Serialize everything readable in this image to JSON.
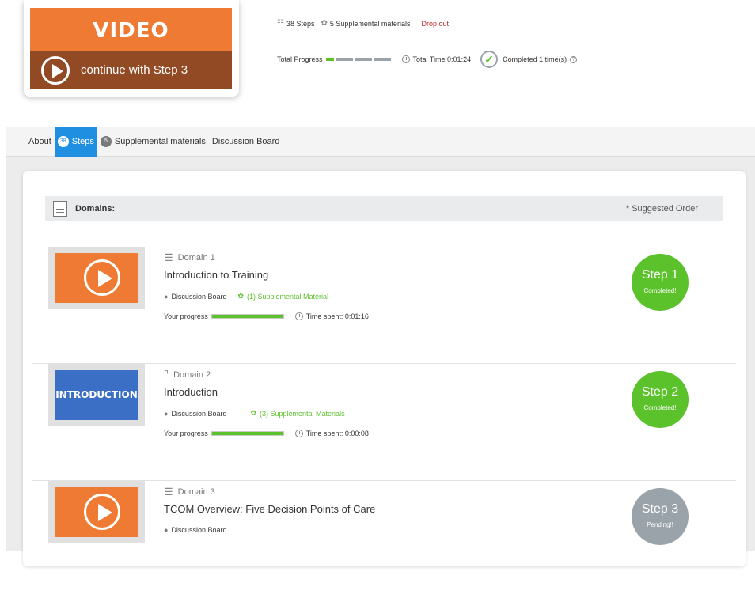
{
  "hero": {
    "video_label": "VIDEO",
    "continue_label": "continue with Step 3"
  },
  "summary": {
    "steps": "38 Steps",
    "supplemental": "5 Supplemental materials",
    "drop_out": "Drop out",
    "total_progress_label": "Total Progress",
    "total_progress_value": 0.05,
    "total_time": "Total Time 0:01:24",
    "completed": "Completed 1 time(s)"
  },
  "tabs": {
    "about": "About",
    "steps_count": "38",
    "steps": "Steps",
    "supp_count": "5",
    "supplemental": "Supplemental materials",
    "discussion": "Discussion Board"
  },
  "domains_header": {
    "title": "Domains:",
    "suggested": "* Suggested Order"
  },
  "steps": [
    {
      "thumb_label": "",
      "domain": "Domain 1",
      "title": "Introduction to Training",
      "discussion": "Discussion Board",
      "supplemental": "(1) Supplemental Material",
      "progress_label": "Your progress",
      "progress": 1.0,
      "time_spent": "Time spent: 0:01:16",
      "badge_step": "Step 1",
      "badge_status": "Completed!",
      "status_color": "#5cc22c"
    },
    {
      "thumb_label": "INTRODUCTION",
      "domain": "Domain 2",
      "title": "Introduction",
      "discussion": "Discussion Board",
      "supplemental": "(3) Supplemental Materials",
      "progress_label": "Your progress",
      "progress": 1.0,
      "time_spent": "Time spent: 0:00:08",
      "badge_step": "Step 2",
      "badge_status": "Completed!",
      "status_color": "#5cc22c"
    },
    {
      "thumb_label": "",
      "domain": "Domain 3",
      "title": "TCOM Overview: Five Decision Points of Care",
      "discussion": "Discussion Board",
      "badge_step": "Step 3",
      "badge_status": "Pending!!",
      "status_color": "#9aa3a9"
    }
  ],
  "colors": {
    "accent_orange": "#ee7a33",
    "tab_active": "#1e8fe1",
    "success_green": "#5cc22c"
  }
}
